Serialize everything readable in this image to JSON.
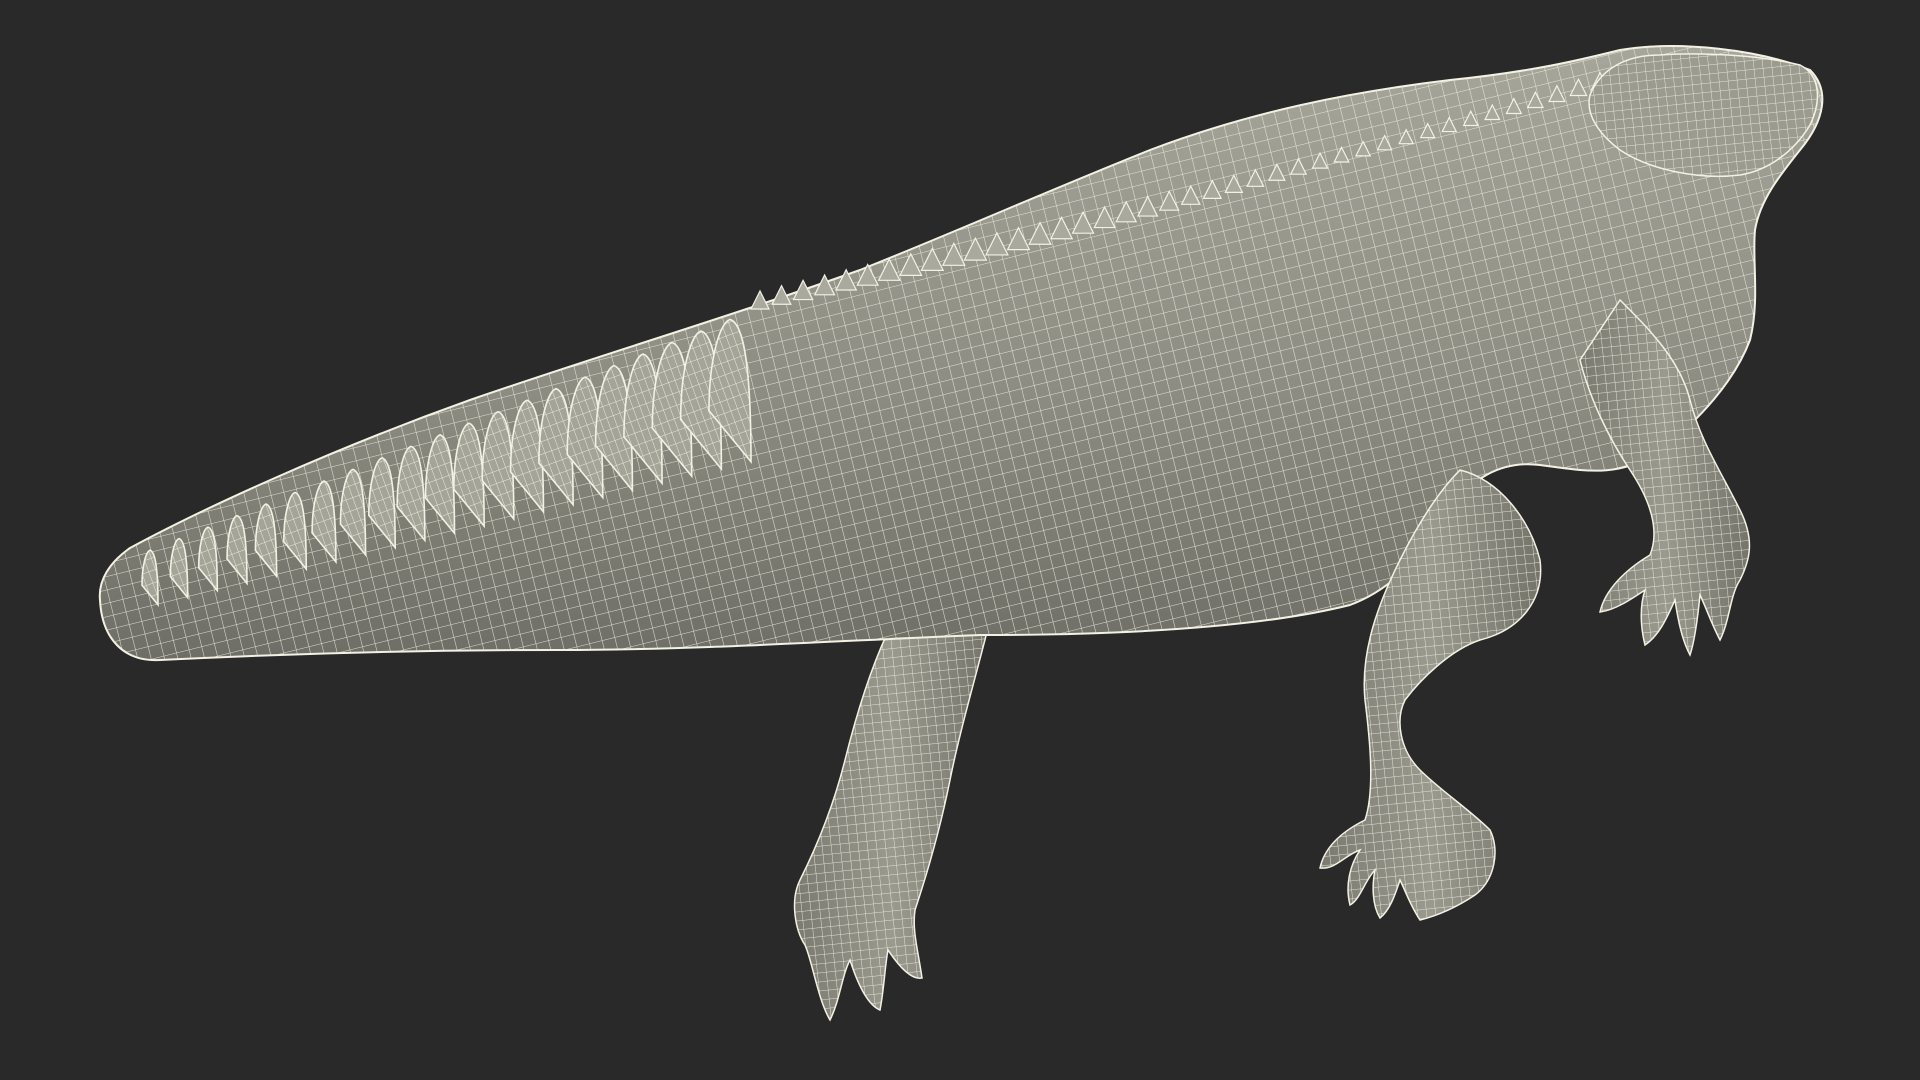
{
  "scene": {
    "subject": "crocodile-wireframe-model",
    "colors": {
      "background": "#292929",
      "mesh_fill": "#8a8a80",
      "mesh_fill_light": "#a3a398",
      "mesh_fill_dark": "#6c6c63",
      "wire": "#f4f1e4"
    }
  }
}
